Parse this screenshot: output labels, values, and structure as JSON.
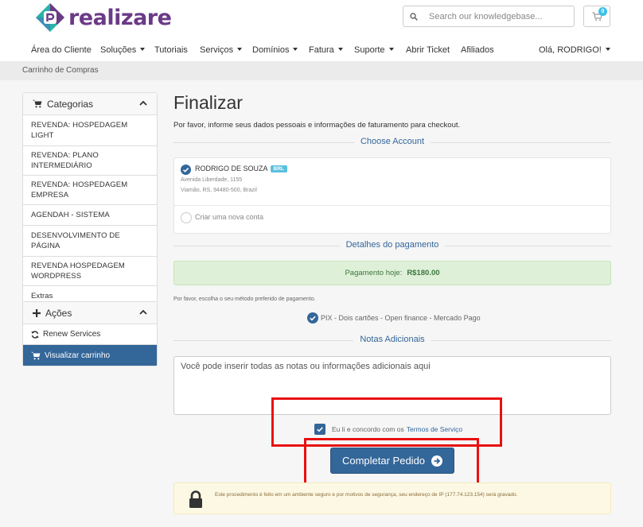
{
  "brand": {
    "name": "realizare",
    "colors": {
      "primary": "#336699",
      "brand_purple": "#6b3a87",
      "brand_teal": "#2ab3a6",
      "highlight_red": "#e81010"
    }
  },
  "header": {
    "search_placeholder": "Search our knowledgebase...",
    "cart_count": "0",
    "icons": {
      "search": "search-icon",
      "cart": "cart-icon"
    }
  },
  "nav": {
    "items": [
      {
        "label": "Área do Cliente",
        "dropdown": false
      },
      {
        "label": "Soluções",
        "dropdown": true
      },
      {
        "label": "Tutoriais",
        "dropdown": false
      },
      {
        "label": "Serviços",
        "dropdown": true
      },
      {
        "label": "Domínios",
        "dropdown": true
      },
      {
        "label": "Fatura",
        "dropdown": true
      },
      {
        "label": "Suporte",
        "dropdown": true
      },
      {
        "label": "Abrir Ticket",
        "dropdown": false
      },
      {
        "label": "Afiliados",
        "dropdown": false
      }
    ],
    "user_greeting": "Olá, RODRIGO!"
  },
  "breadcrumb": "Carrinho de Compras",
  "sidebar": {
    "categories": {
      "title": "Categorias",
      "items": [
        "REVENDA: HOSPEDAGEM LIGHT",
        "REVENDA: PLANO INTERMEDIÁRIO",
        "REVENDA: HOSPEDAGEM EMPRESA",
        "AGENDAH - SISTEMA",
        "DESENVOLVIMENTO DE PÁGINA",
        "REVENDA HOSPEDAGEM WORDPRESS",
        "Extras"
      ]
    },
    "actions": {
      "title": "Ações",
      "items": [
        {
          "label": "Renew Services",
          "icon": "refresh-icon",
          "active": false
        },
        {
          "label": "Visualizar carrinho",
          "icon": "cart-icon",
          "active": true
        }
      ]
    }
  },
  "checkout": {
    "title": "Finalizar",
    "description": "Por favor, informe seus dados pessoais e informações de faturamento para checkout.",
    "choose_account_heading": "Choose Account",
    "account": {
      "name": "RODRIGO DE SOUZA",
      "currency_badge": "BRL",
      "address_line1": "Avenida Liberdade, 1155",
      "address_line2": "Viamão, RS, 94480-500, Brazil",
      "selected": true
    },
    "new_account_label": "Criar uma nova conta",
    "payment_heading": "Detalhes do pagamento",
    "payment_today_label": "Pagamento hoje:",
    "payment_today_amount": "R$180.00",
    "payment_method_note": "Por favor, escolha o seu método preferido de pagamento.",
    "payment_method": "PIX - Dois cartões - Open finance - Mercado Pago",
    "notes_heading": "Notas Adicionais",
    "notes_placeholder": "Você pode inserir todas as notas ou informações adicionais aqui",
    "tos_text": "Eu li e concordo com os",
    "tos_link": "Termos de Serviço",
    "tos_checked": true,
    "complete_button": "Completar Pedido",
    "secure_text": "Este procedimento é feito em um ambiente seguro e por motivos de segurança, seu endereço de IP (177.74.123.154) será gravado."
  }
}
